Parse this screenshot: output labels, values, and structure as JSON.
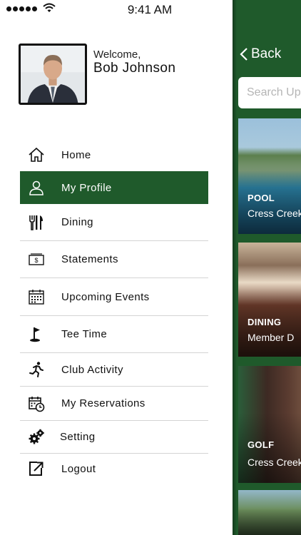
{
  "status_bar": {
    "time": "9:41 AM"
  },
  "background_screen": {
    "back_label": "Back",
    "search_placeholder": "Search Up",
    "cards": [
      {
        "tag": "POOL",
        "subtitle": "Cress Creek"
      },
      {
        "tag": "DINING",
        "subtitle": "Member D"
      },
      {
        "tag": "GOLF",
        "subtitle": "Cress Creek"
      },
      {
        "tag": "",
        "subtitle": ""
      }
    ]
  },
  "profile": {
    "welcome": "Welcome,",
    "name": "Bob Johnson"
  },
  "menu": {
    "items": [
      {
        "label": "Home",
        "icon": "home-icon",
        "active": false
      },
      {
        "label": "My Profile",
        "icon": "person-icon",
        "active": true
      },
      {
        "label": "Dining",
        "icon": "utensils-icon",
        "active": false
      },
      {
        "label": "Statements",
        "icon": "money-bill-icon",
        "active": false
      },
      {
        "label": "Upcoming Events",
        "icon": "calendar-icon",
        "active": false
      },
      {
        "label": "Tee Time",
        "icon": "golf-flag-icon",
        "active": false
      },
      {
        "label": "Club Activity",
        "icon": "running-icon",
        "active": false
      },
      {
        "label": "My Reservations",
        "icon": "calendar-clock-icon",
        "active": false
      },
      {
        "label": "Setting",
        "icon": "gears-icon",
        "active": false
      },
      {
        "label": "Logout",
        "icon": "logout-icon",
        "active": false
      }
    ]
  },
  "colors": {
    "accent_green": "#1f5a2b",
    "divider": "#d4d4d4",
    "text": "#111111"
  }
}
